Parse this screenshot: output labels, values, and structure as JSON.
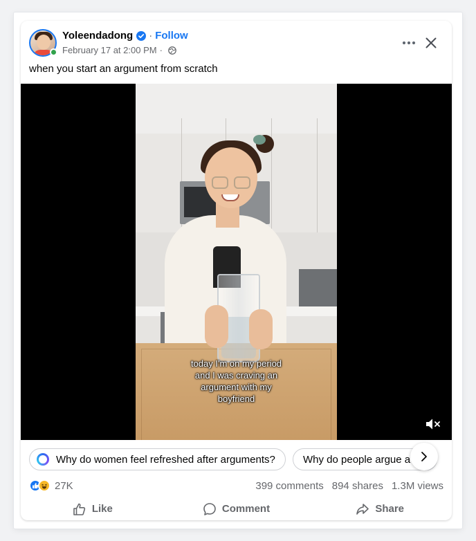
{
  "post": {
    "author": "Yoleendadong",
    "separator": "·",
    "follow_label": "Follow",
    "timestamp": "February 17 at 2:00 PM",
    "meta_separator": "·",
    "audience_icon": "globe-icon",
    "caption": "when you start an argument from scratch"
  },
  "video": {
    "subtitle": "today I'm on my period and I was craving an argument with my boyfriend",
    "mute_icon": "speaker-muted-icon"
  },
  "suggestions": {
    "items": [
      {
        "label": "Why do women feel refreshed after arguments?"
      },
      {
        "label": "Why do people argue a old"
      }
    ]
  },
  "stats": {
    "reaction_count": "27K",
    "comments": "399 comments",
    "shares": "894 shares",
    "views": "1.3M views"
  },
  "actions": {
    "like": "Like",
    "comment": "Comment",
    "share": "Share"
  },
  "colors": {
    "accent": "#1877f2",
    "online": "#31a24c",
    "secondary_text": "#65676b"
  }
}
